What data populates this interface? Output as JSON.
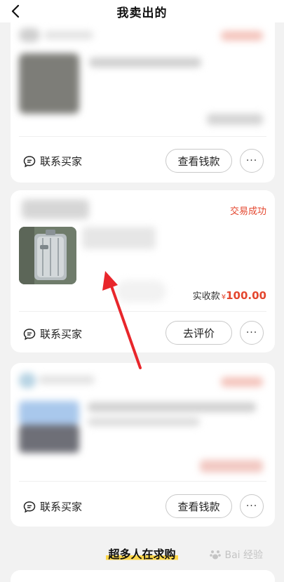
{
  "header": {
    "title": "我卖出的",
    "back_icon": "chevron-left-icon"
  },
  "orders": [
    {
      "contact_label": "联系买家",
      "action_label": "查看钱款",
      "more_label": "···"
    },
    {
      "status": "交易成功",
      "price_label": "实收款",
      "currency": "¥",
      "price": "100.00",
      "contact_label": "联系买家",
      "action_label": "去评价",
      "more_label": "···"
    },
    {
      "contact_label": "联系买家",
      "action_label": "查看钱款",
      "more_label": "···"
    }
  ],
  "section": {
    "title": "超多人在求购"
  },
  "watermark": {
    "text": "Bai  经验"
  },
  "colors": {
    "accent_red": "#e4472f",
    "highlight_yellow": "#ffd84a",
    "annotation_arrow": "#e8262b"
  }
}
